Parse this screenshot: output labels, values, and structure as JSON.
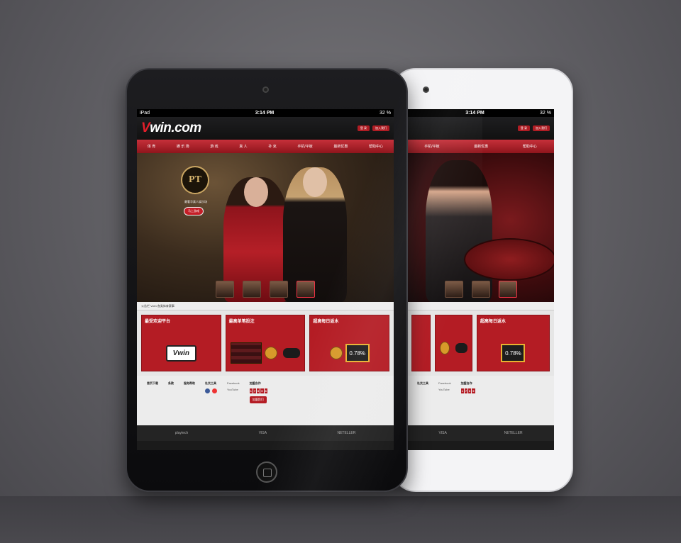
{
  "status": {
    "carrier": "iPad",
    "time": "3:14 PM",
    "battery": "32 %"
  },
  "site": {
    "logo_v": "V",
    "logo_rest": "win.com"
  },
  "header": {
    "login": "登 录",
    "join": "加入我们"
  },
  "nav": [
    "体 育",
    "娱 乐 场",
    "游 戏",
    "真 人",
    "扑 克",
    "手机/平板",
    "最新优惠",
    "帮助中心"
  ],
  "hero": {
    "pt_logo": "PT",
    "tagline": "最奢华真人娱乐场",
    "cta": "马上游戏",
    "thumbs": [
      "",
      "",
      "",
      ""
    ]
  },
  "marquee": "公告栏 Vwin 各类体育赛事",
  "cards": [
    {
      "title": "最受欢迎平台",
      "wbox": "Vwin"
    },
    {
      "title": "最高单笔投注"
    },
    {
      "title": "超高每日返水",
      "rate": "0.78%"
    }
  ],
  "footer": {
    "col1": {
      "head": "首页下载",
      "items": [
        "",
        "",
        "",
        ""
      ]
    },
    "col2": {
      "head": "条款",
      "items": [
        "",
        "",
        "",
        ""
      ]
    },
    "col3": {
      "head": "服务帮助",
      "items": [
        "",
        "",
        "",
        ""
      ]
    },
    "col4": {
      "head": "",
      "items": [
        "",
        "",
        ""
      ]
    },
    "social": {
      "head": "社交工具",
      "items": [
        "",
        "",
        "",
        ""
      ]
    },
    "social2": {
      "items": [
        "Facebook",
        "YouTube",
        ""
      ]
    },
    "join": {
      "head": "加盟合作",
      "counter": [
        "1",
        "7",
        "6",
        "9",
        "8"
      ],
      "btn": "加盟我们"
    }
  },
  "partners": [
    "playtech",
    "",
    "",
    "",
    "",
    "",
    "VISA",
    "NETELLER",
    "",
    ""
  ],
  "white": {
    "nav": [
      "手机/平板",
      "最新优惠",
      "帮助中心"
    ],
    "card_title": "超高每日返水",
    "rate": "0.78%"
  },
  "colors": {
    "accent": "#b41c24",
    "nav": "#a8222a"
  }
}
